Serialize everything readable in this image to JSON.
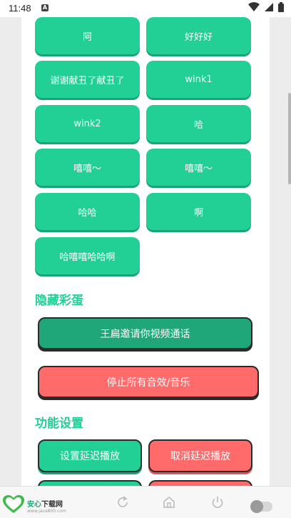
{
  "status": {
    "time": "11:48",
    "notif_letter": "A"
  },
  "effects": [
    "阿",
    "好好好",
    "谢谢献丑了献丑了",
    "wink1",
    "wink2",
    "哈",
    "嘻嘻～",
    "嘻嘻～",
    "哈哈",
    "啊",
    "哈嘻嘻哈哈啊"
  ],
  "hidden_section": {
    "title": "隐藏彩蛋",
    "video_call_btn": "王扁邀请你视频通话"
  },
  "stop_all_btn": "停止所有音效/音乐",
  "settings_section": {
    "title": "功能设置",
    "set_delay_btn": "设置延迟播放",
    "cancel_delay_btn": "取消延迟播放"
  },
  "nav": {
    "logo_title_a": "安心",
    "logo_title_b": "下载网",
    "logo_url": "www.java800.com"
  },
  "colors": {
    "green": "#22d095",
    "dark_green": "#1fa77a",
    "red": "#ff6b6b"
  }
}
